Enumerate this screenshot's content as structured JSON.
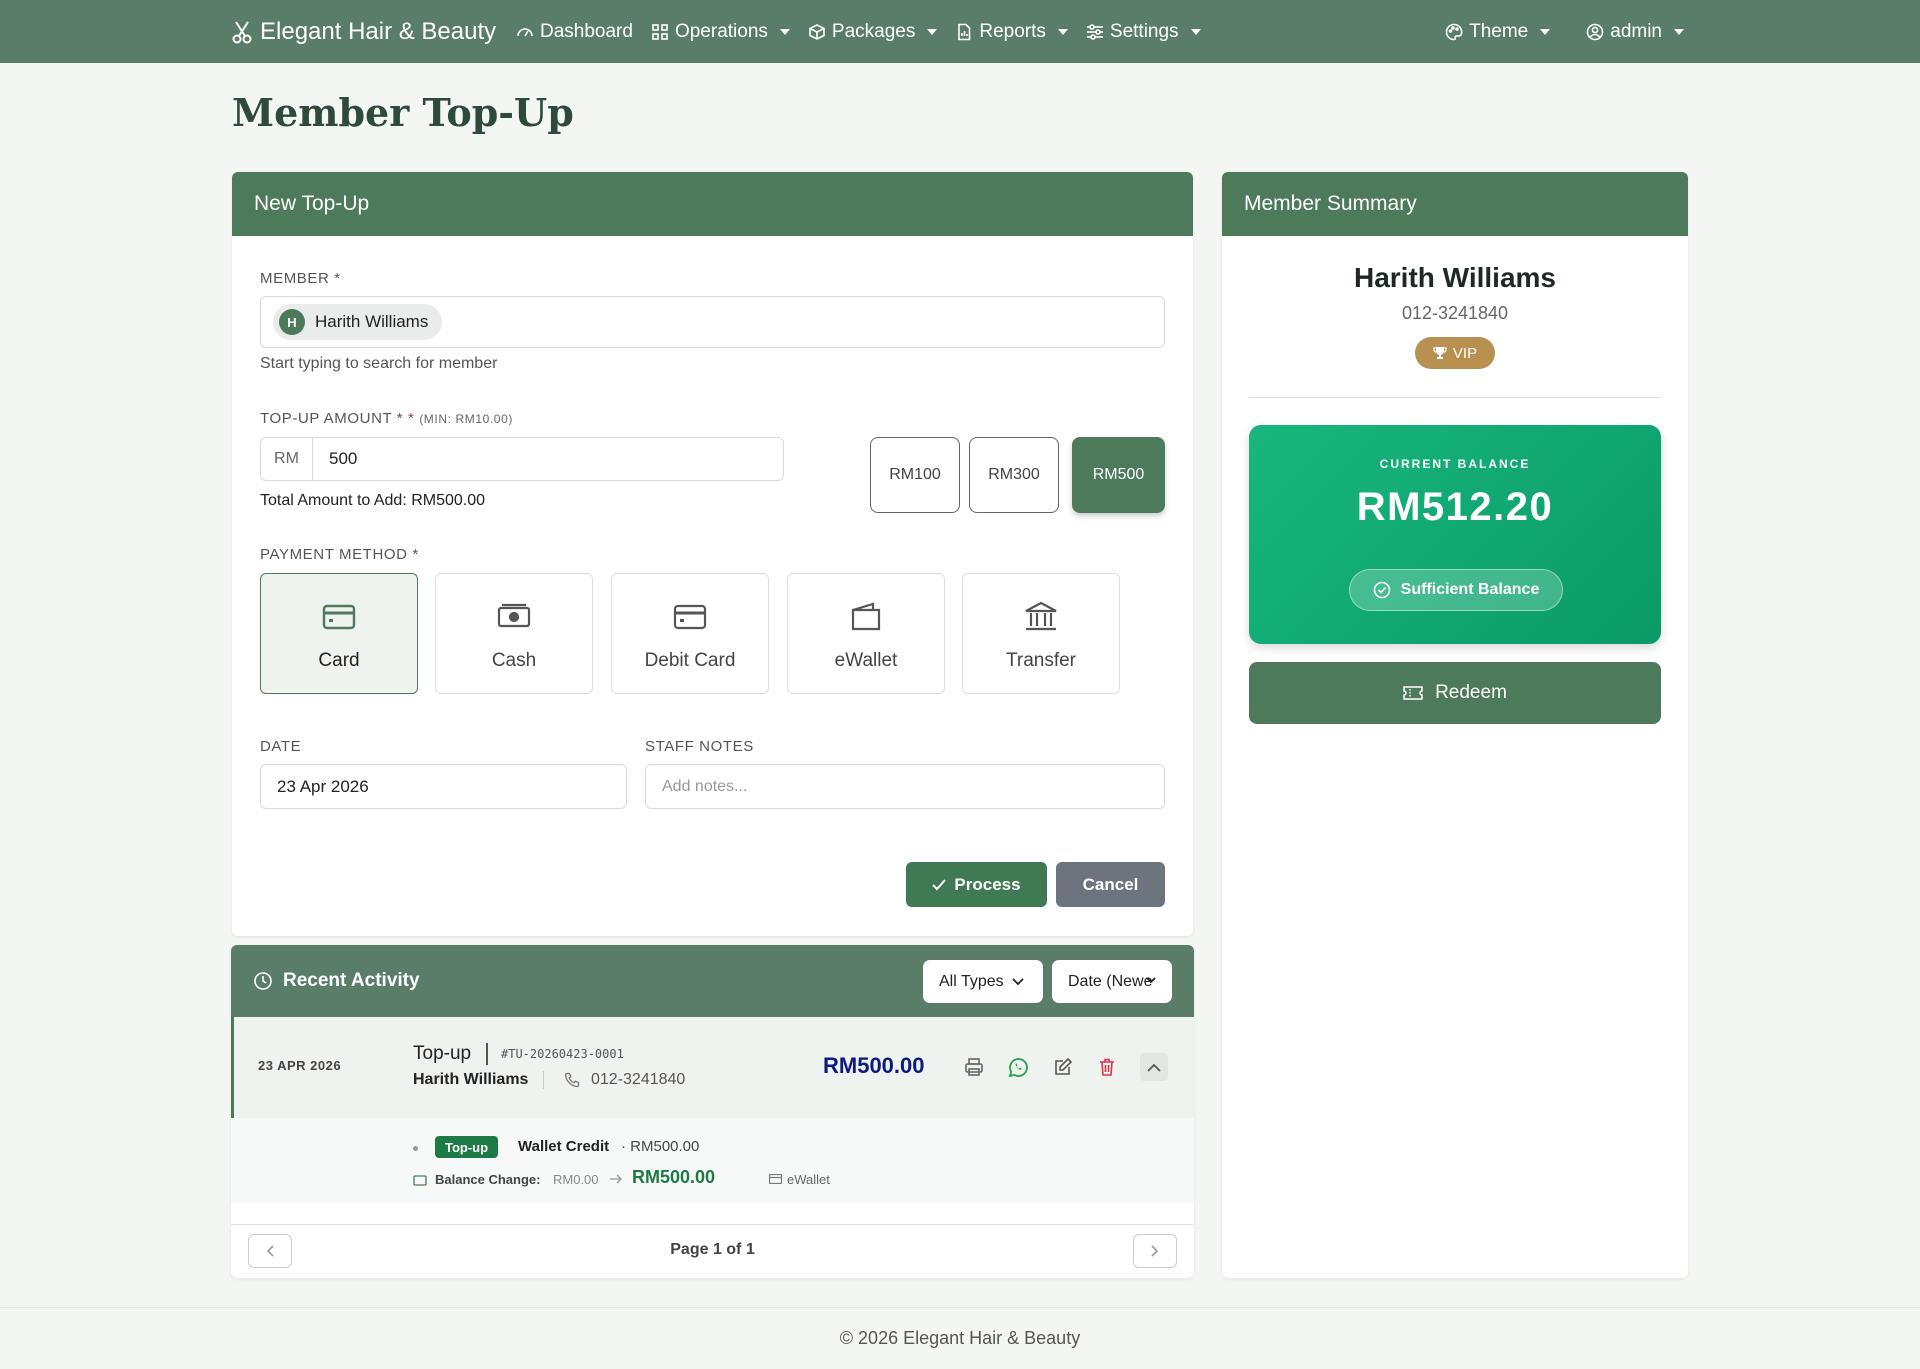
{
  "nav": {
    "brand": "Elegant Hair & Beauty",
    "items": [
      {
        "label": "Dashboard",
        "caret": false
      },
      {
        "label": "Operations",
        "caret": true
      },
      {
        "label": "Packages",
        "caret": true
      },
      {
        "label": "Reports",
        "caret": true
      },
      {
        "label": "Settings",
        "caret": true
      }
    ],
    "theme": "Theme",
    "user": "admin"
  },
  "page": {
    "title": "Member Top-Up"
  },
  "topup": {
    "header": "New Top-Up",
    "member_label": "MEMBER",
    "member_req": "*",
    "member_initial": "H",
    "member_name": "Harith Williams",
    "member_helper": "Start typing to search for member",
    "amount_label": "TOP-UP AMOUNT *",
    "amount_req": "*",
    "amount_min": "(MIN: RM10.00)",
    "currency": "RM",
    "amount_value": "500",
    "total_text": "Total Amount to Add: RM500.00",
    "quick_amounts": [
      "RM100",
      "RM300",
      "RM500"
    ],
    "quick_selected": "RM500",
    "payment_label": "PAYMENT METHOD",
    "payment_req": "*",
    "payment_methods": [
      "Card",
      "Cash",
      "Debit Card",
      "eWallet",
      "Transfer"
    ],
    "payment_selected": "Card",
    "date_label": "DATE",
    "date_value": "23 Apr 2026",
    "notes_label": "STAFF NOTES",
    "notes_placeholder": "Add notes...",
    "process_label": "Process",
    "cancel_label": "Cancel"
  },
  "summary": {
    "header": "Member Summary",
    "name": "Harith Williams",
    "phone": "012-3241840",
    "tier": "VIP",
    "balance_label": "CURRENT BALANCE",
    "balance_value": "RM512.20",
    "balance_status": "Sufficient Balance",
    "redeem_label": "Redeem"
  },
  "activity": {
    "header": "Recent Activity",
    "filter_type": "All Types",
    "filter_sort": "Date (Newe",
    "items": [
      {
        "date": "23 APR 2026",
        "type": "Top-up",
        "ref": "#TU-20260423-0001",
        "member": "Harith Williams",
        "phone": "012-3241840",
        "amount": "RM500.00",
        "badge": "Top-up",
        "line_item": "Wallet Credit",
        "line_amount": "· RM500.00",
        "balance_change_label": "Balance Change:",
        "balance_from": "RM0.00",
        "balance_to": "RM500.00",
        "method": "eWallet"
      }
    ],
    "page_text": "Page 1 of 1"
  },
  "footer": {
    "text": "© 2026 Elegant Hair & Beauty"
  },
  "colors": {
    "primary": "#4d7a5a",
    "navbar": "#5a7d6a",
    "balance": "#12a874",
    "vip": "#b89050",
    "cancel": "#6c757d",
    "amount": "#0d1a80"
  }
}
